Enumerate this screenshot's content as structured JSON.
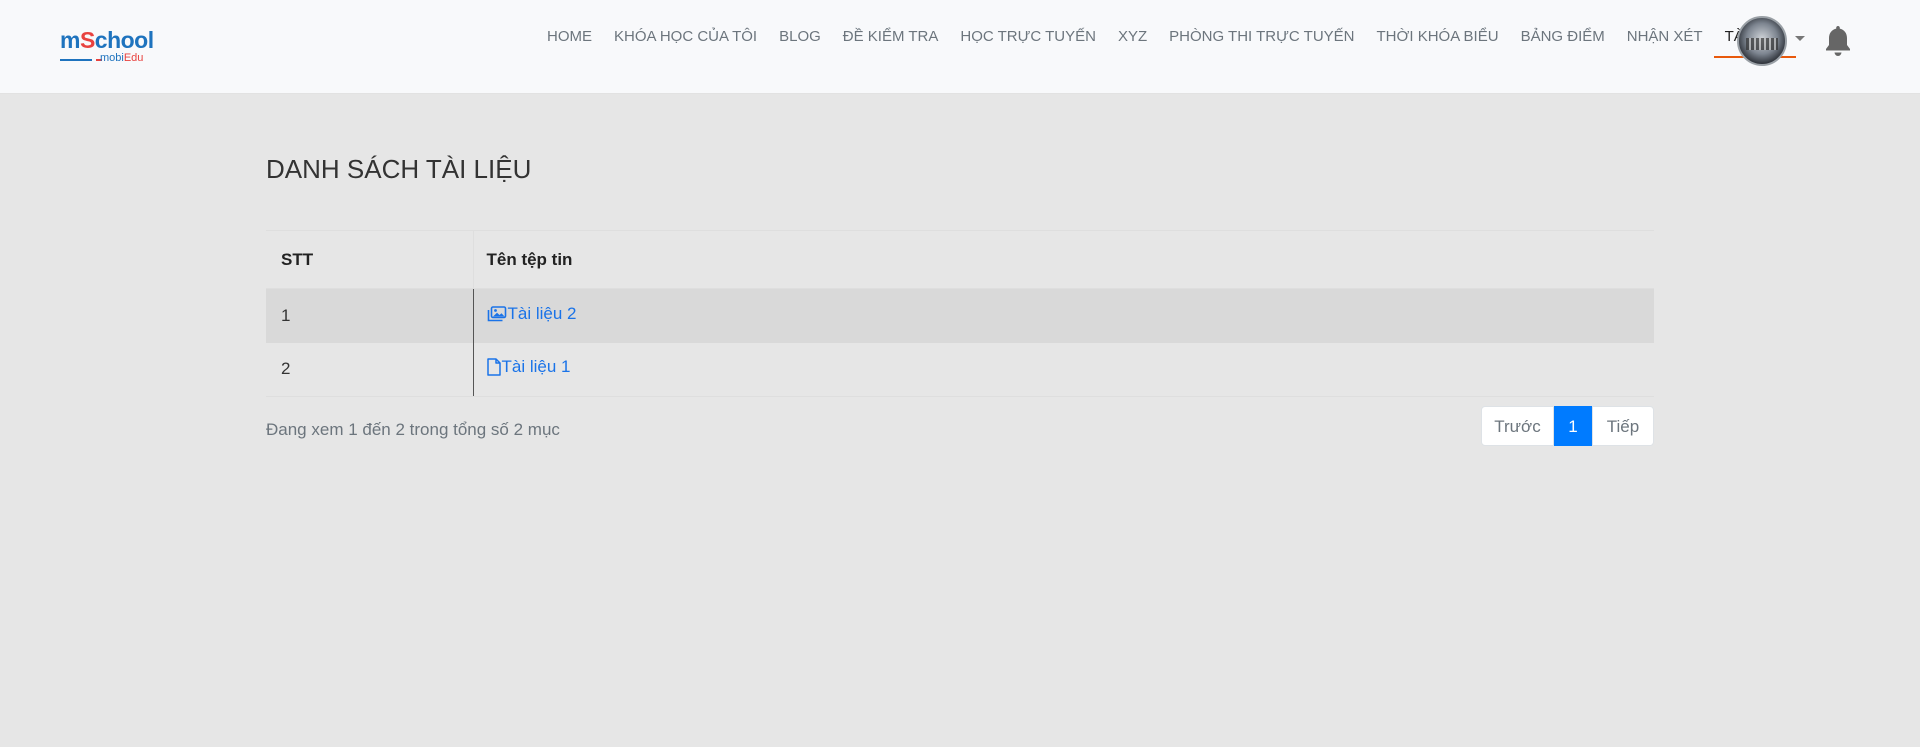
{
  "brand": {
    "logo_main_a": "m",
    "logo_main_b": "S",
    "logo_main_c": "chool",
    "logo_sub_a": "mobi",
    "logo_sub_b": "Edu"
  },
  "nav": {
    "items": [
      {
        "label": "HOME"
      },
      {
        "label": "KHÓA HỌC CỦA TÔI"
      },
      {
        "label": "BLOG"
      },
      {
        "label": "ĐỀ KIỂM TRA"
      },
      {
        "label": "HỌC TRỰC TUYẾN"
      },
      {
        "label": "XYZ"
      },
      {
        "label": "PHÒNG THI TRỰC TUYẾN"
      },
      {
        "label": "THỜI KHÓA BIỂU"
      },
      {
        "label": "BẢNG ĐIỂM"
      },
      {
        "label": "NHẬN XÉT"
      },
      {
        "label": "TÀI LIỆU"
      }
    ],
    "active_index": 10
  },
  "page": {
    "title": "DANH SÁCH TÀI LIỆU"
  },
  "table": {
    "headers": [
      "STT",
      "Tên tệp tin"
    ],
    "rows": [
      {
        "stt": "1",
        "name": "Tài liệu 2",
        "icon": "image-icon"
      },
      {
        "stt": "2",
        "name": "Tài liệu 1",
        "icon": "file-icon"
      }
    ]
  },
  "footer": {
    "info": "Đang xem 1 đến 2 trong tổng số 2 mục"
  },
  "pagination": {
    "prev": "Trước",
    "current": "1",
    "next": "Tiếp"
  },
  "colors": {
    "accent": "#007bff",
    "active_underline": "#e8590c",
    "link": "#1a73e8"
  },
  "icons": {
    "bell": "bell-icon",
    "caret": "caret-down-icon"
  }
}
